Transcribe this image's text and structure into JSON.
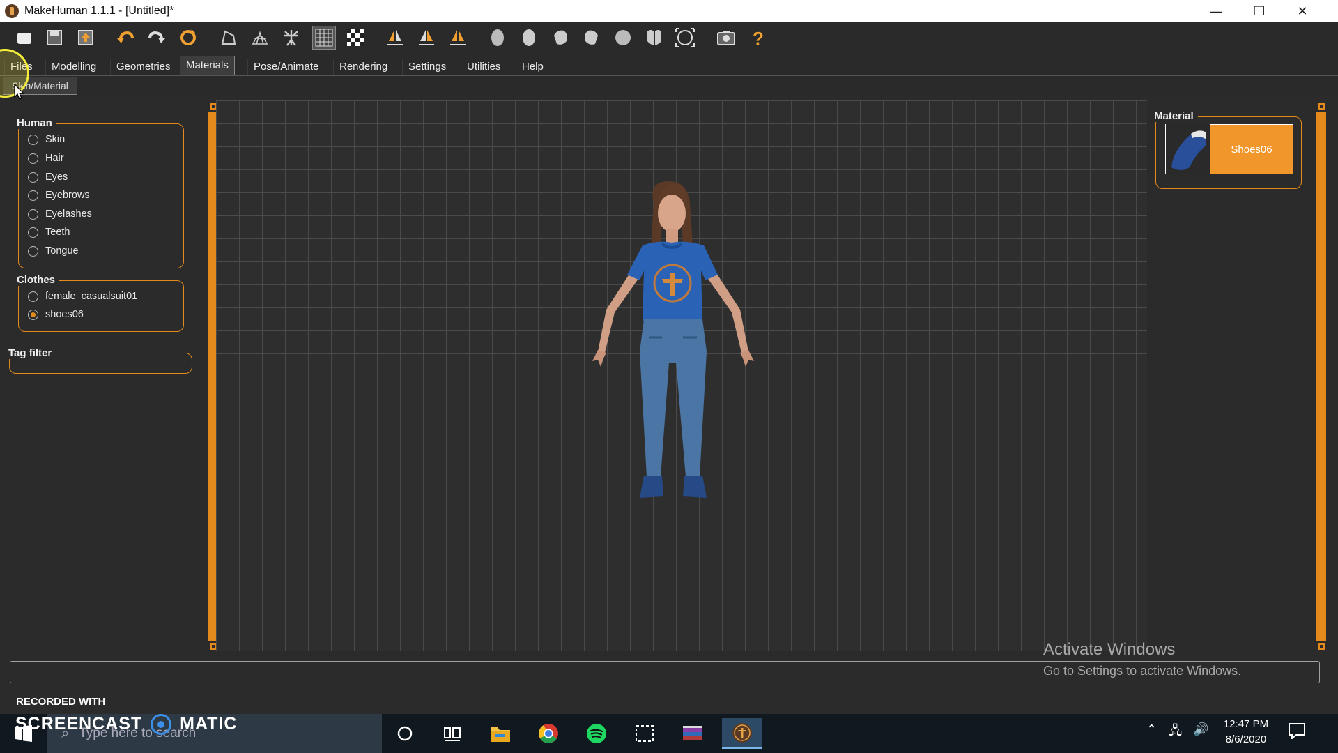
{
  "window": {
    "title": "MakeHuman 1.1.1 - [Untitled]*"
  },
  "toolbar_icons": [
    "new-file",
    "save",
    "export",
    "undo",
    "redo",
    "reset",
    "smooth",
    "wireframe",
    "skeleton",
    "grid",
    "checkerboard",
    "symmetry-right",
    "symmetry-left",
    "symmetry",
    "front-view",
    "back-view",
    "left-view",
    "right-view",
    "top-view",
    "bottom-view",
    "reset-camera",
    "screenshot",
    "help"
  ],
  "menu": {
    "tabs": [
      "Files",
      "Modelling",
      "Geometries",
      "Materials",
      "Pose/Animate",
      "Rendering",
      "Settings",
      "Utilities",
      "Help"
    ],
    "active": "Materials",
    "subtab": "Skin/Material"
  },
  "human": {
    "title": "Human",
    "items": [
      "Skin",
      "Hair",
      "Eyes",
      "Eyebrows",
      "Eyelashes",
      "Teeth",
      "Tongue"
    ]
  },
  "clothes": {
    "title": "Clothes",
    "items": [
      "female_casualsuit01",
      "shoes06"
    ],
    "selected": "shoes06"
  },
  "tag_filter": {
    "title": "Tag filter",
    "value": ""
  },
  "material": {
    "title": "Material",
    "selected_label": "Shoes06"
  },
  "watermark": {
    "line1": "Activate Windows",
    "line2": "Go to Settings to activate Windows."
  },
  "recorder": {
    "recorded_with": "RECORDED WITH",
    "brand": "SCREENCAST",
    "brand2": "MATIC"
  },
  "taskbar": {
    "search_placeholder": "Type here to search",
    "time": "12:47 PM",
    "date": "8/6/2020"
  },
  "colors": {
    "accent": "#e48a1c",
    "background": "#2b2b2b",
    "shirt": "#2a63b5"
  }
}
